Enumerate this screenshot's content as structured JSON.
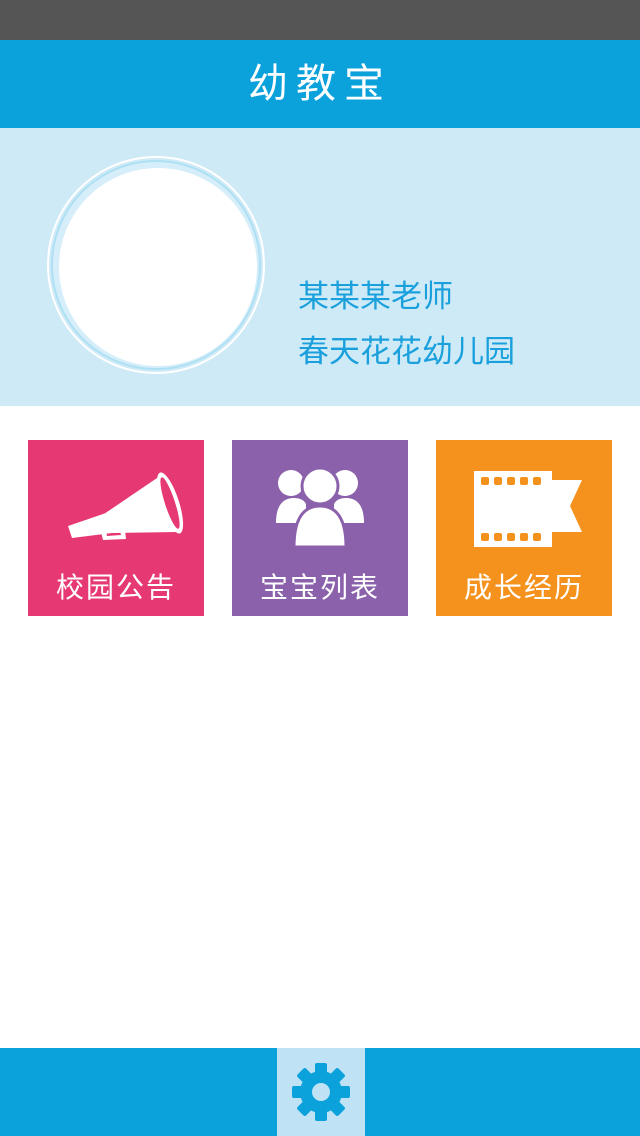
{
  "app": {
    "title": "幼教宝"
  },
  "profile": {
    "teacher_name": "某某某老师",
    "school_name": "春天花花幼儿园"
  },
  "menu": {
    "tiles": [
      {
        "label": "校园公告",
        "icon": "megaphone-icon",
        "color": "#e63873"
      },
      {
        "label": "宝宝列表",
        "icon": "group-icon",
        "color": "#8a61aa"
      },
      {
        "label": "成长经历",
        "icon": "film-strip-icon",
        "color": "#f5921e"
      }
    ]
  },
  "bottom_bar": {
    "settings_icon": "gear-icon"
  },
  "colors": {
    "accent": "#0ba2dc",
    "profile_background": "#cfeaf7",
    "status_bar": "#555555"
  }
}
